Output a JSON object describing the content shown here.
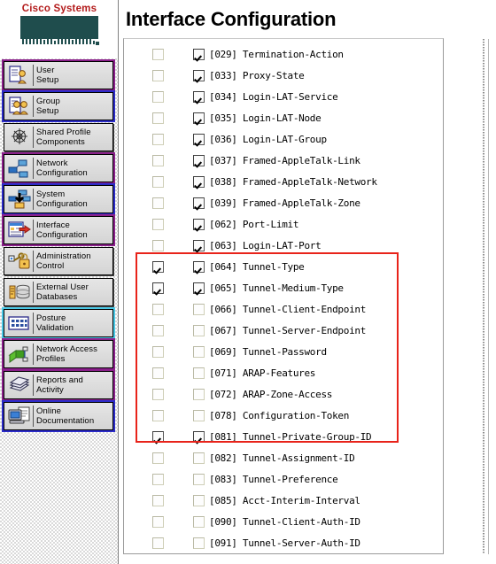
{
  "brand": {
    "line1": "Cisco Systems",
    "logo_name": "cisco-systems-logo"
  },
  "sidebar": {
    "items": [
      {
        "label": "User\nSetup",
        "icon": "user-setup-icon",
        "state": "purple"
      },
      {
        "label": "Group\nSetup",
        "icon": "group-setup-icon",
        "state": "blue"
      },
      {
        "label": "Shared Profile\nComponents",
        "icon": "shared-profile-icon",
        "state": "none"
      },
      {
        "label": "Network\nConfiguration",
        "icon": "network-configuration-icon",
        "state": "purple"
      },
      {
        "label": "System\nConfiguration",
        "icon": "system-configuration-icon",
        "state": "blue"
      },
      {
        "label": "Interface\nConfiguration",
        "icon": "interface-configuration-icon",
        "state": "purple"
      },
      {
        "label": "Administration\nControl",
        "icon": "administration-control-icon",
        "state": "none"
      },
      {
        "label": "External User\nDatabases",
        "icon": "external-user-databases-icon",
        "state": "none"
      },
      {
        "label": "Posture\nValidation",
        "icon": "posture-validation-icon",
        "state": "cyan"
      },
      {
        "label": "Network Access\nProfiles",
        "icon": "network-access-profiles-icon",
        "state": "purple"
      },
      {
        "label": "Reports and\nActivity",
        "icon": "reports-and-activity-icon",
        "state": "purple"
      },
      {
        "label": "Online\nDocumentation",
        "icon": "online-documentation-icon",
        "state": "blue"
      }
    ]
  },
  "main": {
    "title": "Interface Configuration",
    "attributes": [
      {
        "label": "[029] Termination-Action",
        "user": false,
        "group": true
      },
      {
        "label": "[033] Proxy-State",
        "user": false,
        "group": true
      },
      {
        "label": "[034] Login-LAT-Service",
        "user": false,
        "group": true
      },
      {
        "label": "[035] Login-LAT-Node",
        "user": false,
        "group": true
      },
      {
        "label": "[036] Login-LAT-Group",
        "user": false,
        "group": true
      },
      {
        "label": "[037] Framed-AppleTalk-Link",
        "user": false,
        "group": true
      },
      {
        "label": "[038] Framed-AppleTalk-Network",
        "user": false,
        "group": true
      },
      {
        "label": "[039] Framed-AppleTalk-Zone",
        "user": false,
        "group": true
      },
      {
        "label": "[062] Port-Limit",
        "user": false,
        "group": true
      },
      {
        "label": "[063] Login-LAT-Port",
        "user": false,
        "group": true
      },
      {
        "label": "[064] Tunnel-Type",
        "user": true,
        "group": true
      },
      {
        "label": "[065] Tunnel-Medium-Type",
        "user": true,
        "group": true
      },
      {
        "label": "[066] Tunnel-Client-Endpoint",
        "user": false,
        "group": false
      },
      {
        "label": "[067] Tunnel-Server-Endpoint",
        "user": false,
        "group": false
      },
      {
        "label": "[069] Tunnel-Password",
        "user": false,
        "group": false
      },
      {
        "label": "[071] ARAP-Features",
        "user": false,
        "group": false
      },
      {
        "label": "[072] ARAP-Zone-Access",
        "user": false,
        "group": false
      },
      {
        "label": "[078] Configuration-Token",
        "user": false,
        "group": false
      },
      {
        "label": "[081] Tunnel-Private-Group-ID",
        "user": true,
        "group": true
      },
      {
        "label": "[082] Tunnel-Assignment-ID",
        "user": false,
        "group": false
      },
      {
        "label": "[083] Tunnel-Preference",
        "user": false,
        "group": false
      },
      {
        "label": "[085] Acct-Interim-Interval",
        "user": false,
        "group": false
      },
      {
        "label": "[090] Tunnel-Client-Auth-ID",
        "user": false,
        "group": false
      },
      {
        "label": "[091] Tunnel-Server-Auth-ID",
        "user": false,
        "group": false
      }
    ]
  },
  "annotation": {
    "highlight_color": "#e8231a",
    "name": "tunnel-attributes-highlight"
  },
  "colors": {
    "brand_red": "#b31b1b",
    "annotation_red": "#e8231a",
    "sidebar_bg": "#d9d9d9"
  }
}
